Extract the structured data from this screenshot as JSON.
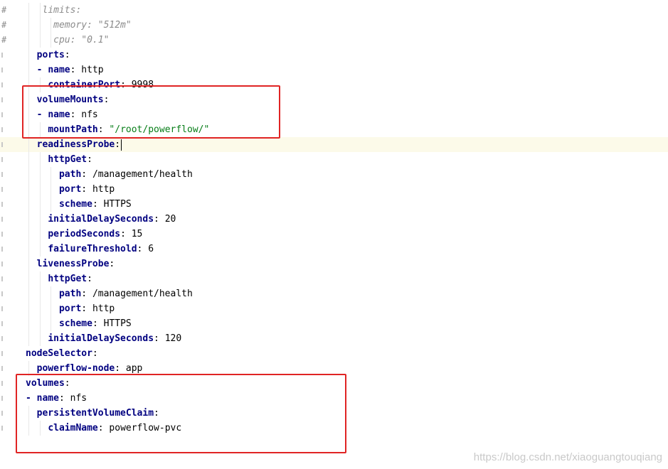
{
  "editor": {
    "lines": [
      {
        "marker": "#",
        "comment": true,
        "indent": 5,
        "parts": [
          {
            "t": "comment",
            "v": "limits:"
          }
        ]
      },
      {
        "marker": "#",
        "comment": true,
        "indent": 7,
        "parts": [
          {
            "t": "comment",
            "v": "memory: \"512m\""
          }
        ]
      },
      {
        "marker": "#",
        "comment": true,
        "indent": 7,
        "parts": [
          {
            "t": "comment",
            "v": "cpu: \"0.1\""
          }
        ]
      },
      {
        "marker": "",
        "indent": 4,
        "parts": [
          {
            "t": "key",
            "v": "ports"
          },
          {
            "t": "colon",
            "v": ":"
          }
        ]
      },
      {
        "marker": "",
        "indent": 4,
        "parts": [
          {
            "t": "dash",
            "v": "- "
          },
          {
            "t": "key",
            "v": "name"
          },
          {
            "t": "colon",
            "v": ": "
          },
          {
            "t": "val",
            "v": "http"
          }
        ]
      },
      {
        "marker": "",
        "indent": 6,
        "parts": [
          {
            "t": "key",
            "v": "containerPort"
          },
          {
            "t": "colon",
            "v": ": "
          },
          {
            "t": "val",
            "v": "9998"
          }
        ]
      },
      {
        "marker": "",
        "indent": 4,
        "parts": [
          {
            "t": "key",
            "v": "volumeMounts"
          },
          {
            "t": "colon",
            "v": ":"
          }
        ]
      },
      {
        "marker": "",
        "indent": 4,
        "parts": [
          {
            "t": "dash",
            "v": "- "
          },
          {
            "t": "key",
            "v": "name"
          },
          {
            "t": "colon",
            "v": ": "
          },
          {
            "t": "val",
            "v": "nfs"
          }
        ]
      },
      {
        "marker": "",
        "indent": 6,
        "parts": [
          {
            "t": "key",
            "v": "mountPath"
          },
          {
            "t": "colon",
            "v": ": "
          },
          {
            "t": "str",
            "v": "\"/root/powerflow/\""
          }
        ]
      },
      {
        "marker": "",
        "indent": 4,
        "current": true,
        "parts": [
          {
            "t": "key",
            "v": "readinessProbe"
          },
          {
            "t": "colon",
            "v": ":"
          }
        ]
      },
      {
        "marker": "",
        "indent": 6,
        "parts": [
          {
            "t": "key",
            "v": "httpGet"
          },
          {
            "t": "colon",
            "v": ":"
          }
        ]
      },
      {
        "marker": "",
        "indent": 8,
        "parts": [
          {
            "t": "key",
            "v": "path"
          },
          {
            "t": "colon",
            "v": ": "
          },
          {
            "t": "val",
            "v": "/management/health"
          }
        ]
      },
      {
        "marker": "",
        "indent": 8,
        "parts": [
          {
            "t": "key",
            "v": "port"
          },
          {
            "t": "colon",
            "v": ": "
          },
          {
            "t": "val",
            "v": "http"
          }
        ]
      },
      {
        "marker": "",
        "indent": 8,
        "parts": [
          {
            "t": "key",
            "v": "scheme"
          },
          {
            "t": "colon",
            "v": ": "
          },
          {
            "t": "val",
            "v": "HTTPS"
          }
        ]
      },
      {
        "marker": "",
        "indent": 6,
        "parts": [
          {
            "t": "key",
            "v": "initialDelaySeconds"
          },
          {
            "t": "colon",
            "v": ": "
          },
          {
            "t": "val",
            "v": "20"
          }
        ]
      },
      {
        "marker": "",
        "indent": 6,
        "parts": [
          {
            "t": "key",
            "v": "periodSeconds"
          },
          {
            "t": "colon",
            "v": ": "
          },
          {
            "t": "val",
            "v": "15"
          }
        ]
      },
      {
        "marker": "",
        "indent": 6,
        "parts": [
          {
            "t": "key",
            "v": "failureThreshold"
          },
          {
            "t": "colon",
            "v": ": "
          },
          {
            "t": "val",
            "v": "6"
          }
        ]
      },
      {
        "marker": "",
        "indent": 4,
        "parts": [
          {
            "t": "key",
            "v": "livenessProbe"
          },
          {
            "t": "colon",
            "v": ":"
          }
        ]
      },
      {
        "marker": "",
        "indent": 6,
        "parts": [
          {
            "t": "key",
            "v": "httpGet"
          },
          {
            "t": "colon",
            "v": ":"
          }
        ]
      },
      {
        "marker": "",
        "indent": 8,
        "parts": [
          {
            "t": "key",
            "v": "path"
          },
          {
            "t": "colon",
            "v": ": "
          },
          {
            "t": "val",
            "v": "/management/health"
          }
        ]
      },
      {
        "marker": "",
        "indent": 8,
        "parts": [
          {
            "t": "key",
            "v": "port"
          },
          {
            "t": "colon",
            "v": ": "
          },
          {
            "t": "val",
            "v": "http"
          }
        ]
      },
      {
        "marker": "",
        "indent": 8,
        "parts": [
          {
            "t": "key",
            "v": "scheme"
          },
          {
            "t": "colon",
            "v": ": "
          },
          {
            "t": "val",
            "v": "HTTPS"
          }
        ]
      },
      {
        "marker": "",
        "indent": 6,
        "parts": [
          {
            "t": "key",
            "v": "initialDelaySeconds"
          },
          {
            "t": "colon",
            "v": ": "
          },
          {
            "t": "val",
            "v": "120"
          }
        ]
      },
      {
        "marker": "",
        "indent": 2,
        "parts": [
          {
            "t": "key",
            "v": "nodeSelector"
          },
          {
            "t": "colon",
            "v": ":"
          }
        ]
      },
      {
        "marker": "",
        "indent": 4,
        "parts": [
          {
            "t": "key",
            "v": "powerflow-node"
          },
          {
            "t": "colon",
            "v": ": "
          },
          {
            "t": "val",
            "v": "app"
          }
        ]
      },
      {
        "marker": "",
        "indent": 2,
        "parts": [
          {
            "t": "key",
            "v": "volumes"
          },
          {
            "t": "colon",
            "v": ":"
          }
        ]
      },
      {
        "marker": "",
        "indent": 2,
        "parts": [
          {
            "t": "dash",
            "v": "- "
          },
          {
            "t": "key",
            "v": "name"
          },
          {
            "t": "colon",
            "v": ": "
          },
          {
            "t": "val",
            "v": "nfs"
          }
        ]
      },
      {
        "marker": "",
        "indent": 4,
        "parts": [
          {
            "t": "key",
            "v": "persistentVolumeClaim"
          },
          {
            "t": "colon",
            "v": ":"
          }
        ]
      },
      {
        "marker": "",
        "indent": 6,
        "parts": [
          {
            "t": "key",
            "v": "claimName"
          },
          {
            "t": "colon",
            "v": ": "
          },
          {
            "t": "val",
            "v": "powerflow-pvc"
          }
        ]
      }
    ]
  },
  "annotations": {
    "box_color": "#e02424"
  },
  "watermark": "https://blog.csdn.net/xiaoguangtouqiang"
}
